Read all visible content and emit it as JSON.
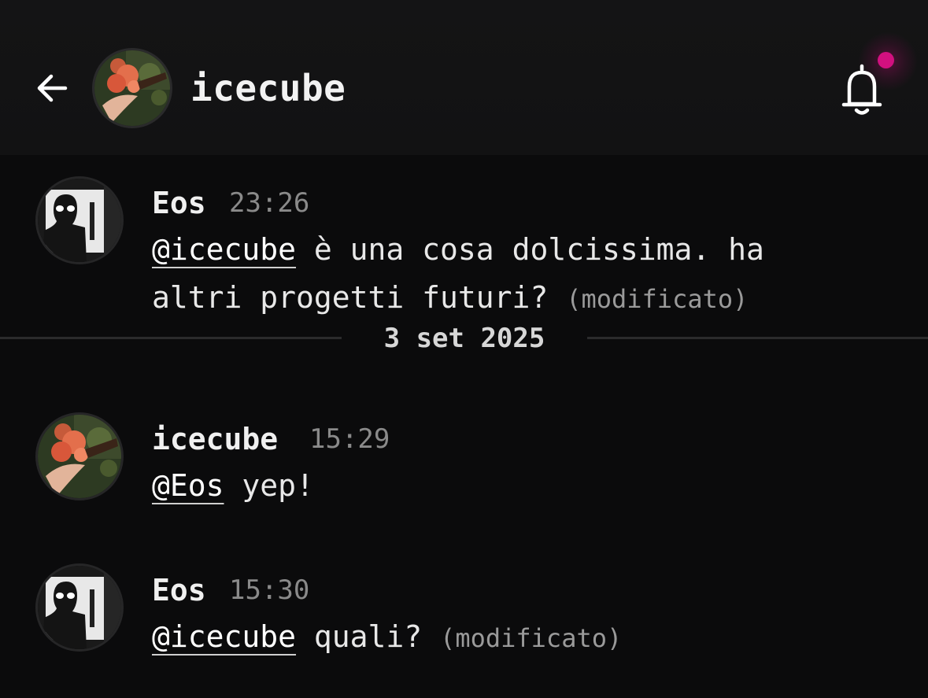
{
  "header": {
    "title": "icecube",
    "back_icon": "arrow-left-icon",
    "bell_icon": "bell-icon",
    "notification_dot_color": "#d1107f"
  },
  "date_separator": "3 set 2025",
  "messages": [
    {
      "author": "Eos",
      "time": "23:26",
      "mention": "@icecube",
      "text_line1": " è una cosa dolcissima. ha",
      "text_line2": "altri progetti futuri? ",
      "edited": "(modificato)"
    },
    {
      "author": "icecube",
      "time": "15:29",
      "mention": "@Eos",
      "text": " yep!"
    },
    {
      "author": "Eos",
      "time": "15:30",
      "mention": "@icecube",
      "text": " quali? ",
      "edited": "(modificato)"
    }
  ],
  "colors": {
    "background": "#0b0b0c",
    "header_background": "#131314",
    "accent": "#d1107f"
  }
}
